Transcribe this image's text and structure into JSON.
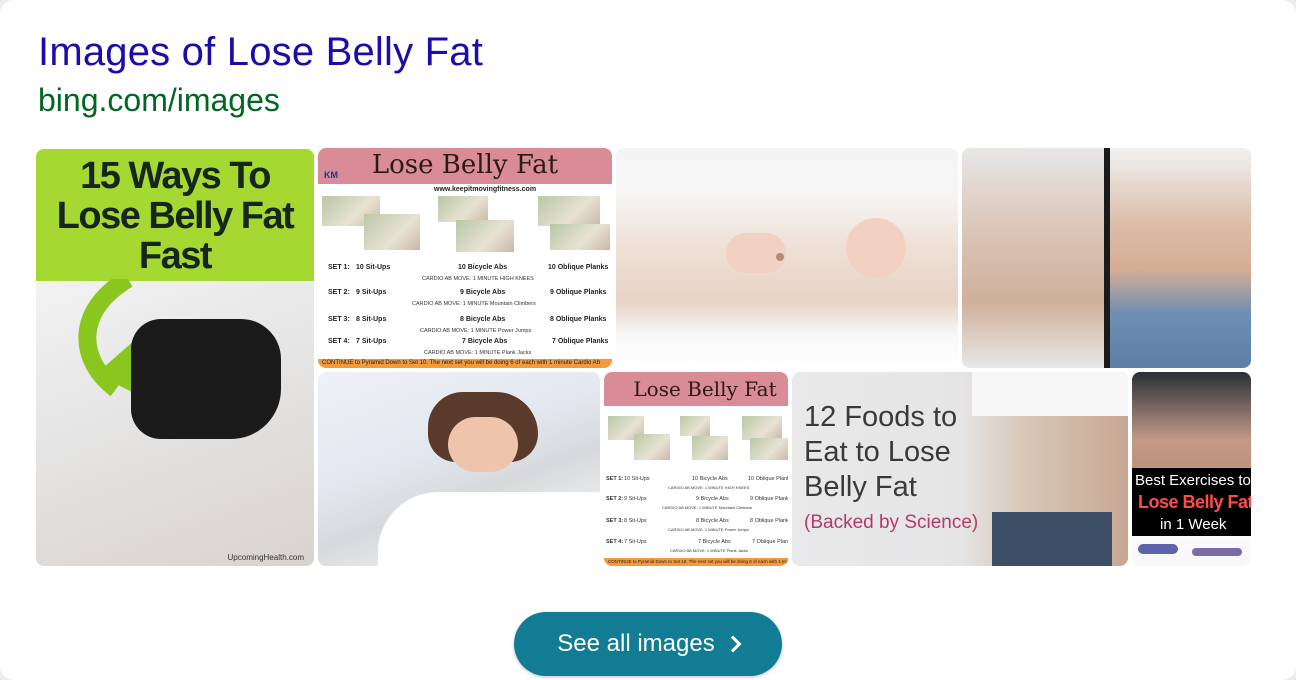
{
  "header": {
    "title": "Images of Lose Belly Fat",
    "source": "bing.com/images"
  },
  "tiles": {
    "t1": {
      "line1": "15 Ways To",
      "line2": "Lose Belly Fat",
      "line3": "Fast",
      "credit": "UpcomingHealth.com"
    },
    "chart": {
      "banner": "Lose Belly Fat",
      "logo": "KM",
      "url": "www.keepitmovingfitness.com",
      "rows": [
        {
          "set": "SET 1:",
          "a": "10 Sit-Ups",
          "b": "10 Bicycle Abs",
          "c": "10 Oblique Planks",
          "cardio": "CARDIO AB MOVE: 1 MINUTE  HIGH KNEES"
        },
        {
          "set": "SET 2:",
          "a": "9 Sit-Ups",
          "b": "9 Bicycle Abs",
          "c": "9 Oblique Planks",
          "cardio": "CARDIO AB MOVE: 1 MINUTE  Mountain Climbers"
        },
        {
          "set": "SET 3:",
          "a": "8 Sit-Ups",
          "b": "8 Bicycle Abs",
          "c": "8 Oblique Planks",
          "cardio": "CARDIO AB MOVE: 1 MINUTE  Power Jumps"
        },
        {
          "set": "SET 4:",
          "a": "7 Sit-Ups",
          "b": "7 Bicycle Abs",
          "c": "7 Oblique Planks",
          "cardio": "CARDIO AB MOVE: 1 MINUTE  Plank Jacks"
        }
      ],
      "footer": "CONTINUE to Pyramid Down to Set 10. The next set you will be doing 6 of each with 1 minute Cardio Ab"
    },
    "foods": {
      "line1": "12 Foods to",
      "line2": "Eat to Lose",
      "line3": "Belly Fat",
      "sub": "(Backed by Science)"
    },
    "best": {
      "line1": "Best Exercises to",
      "line2": "Lose Belly Fat",
      "line3": "in 1 Week"
    }
  },
  "button": {
    "label": "See all images"
  }
}
